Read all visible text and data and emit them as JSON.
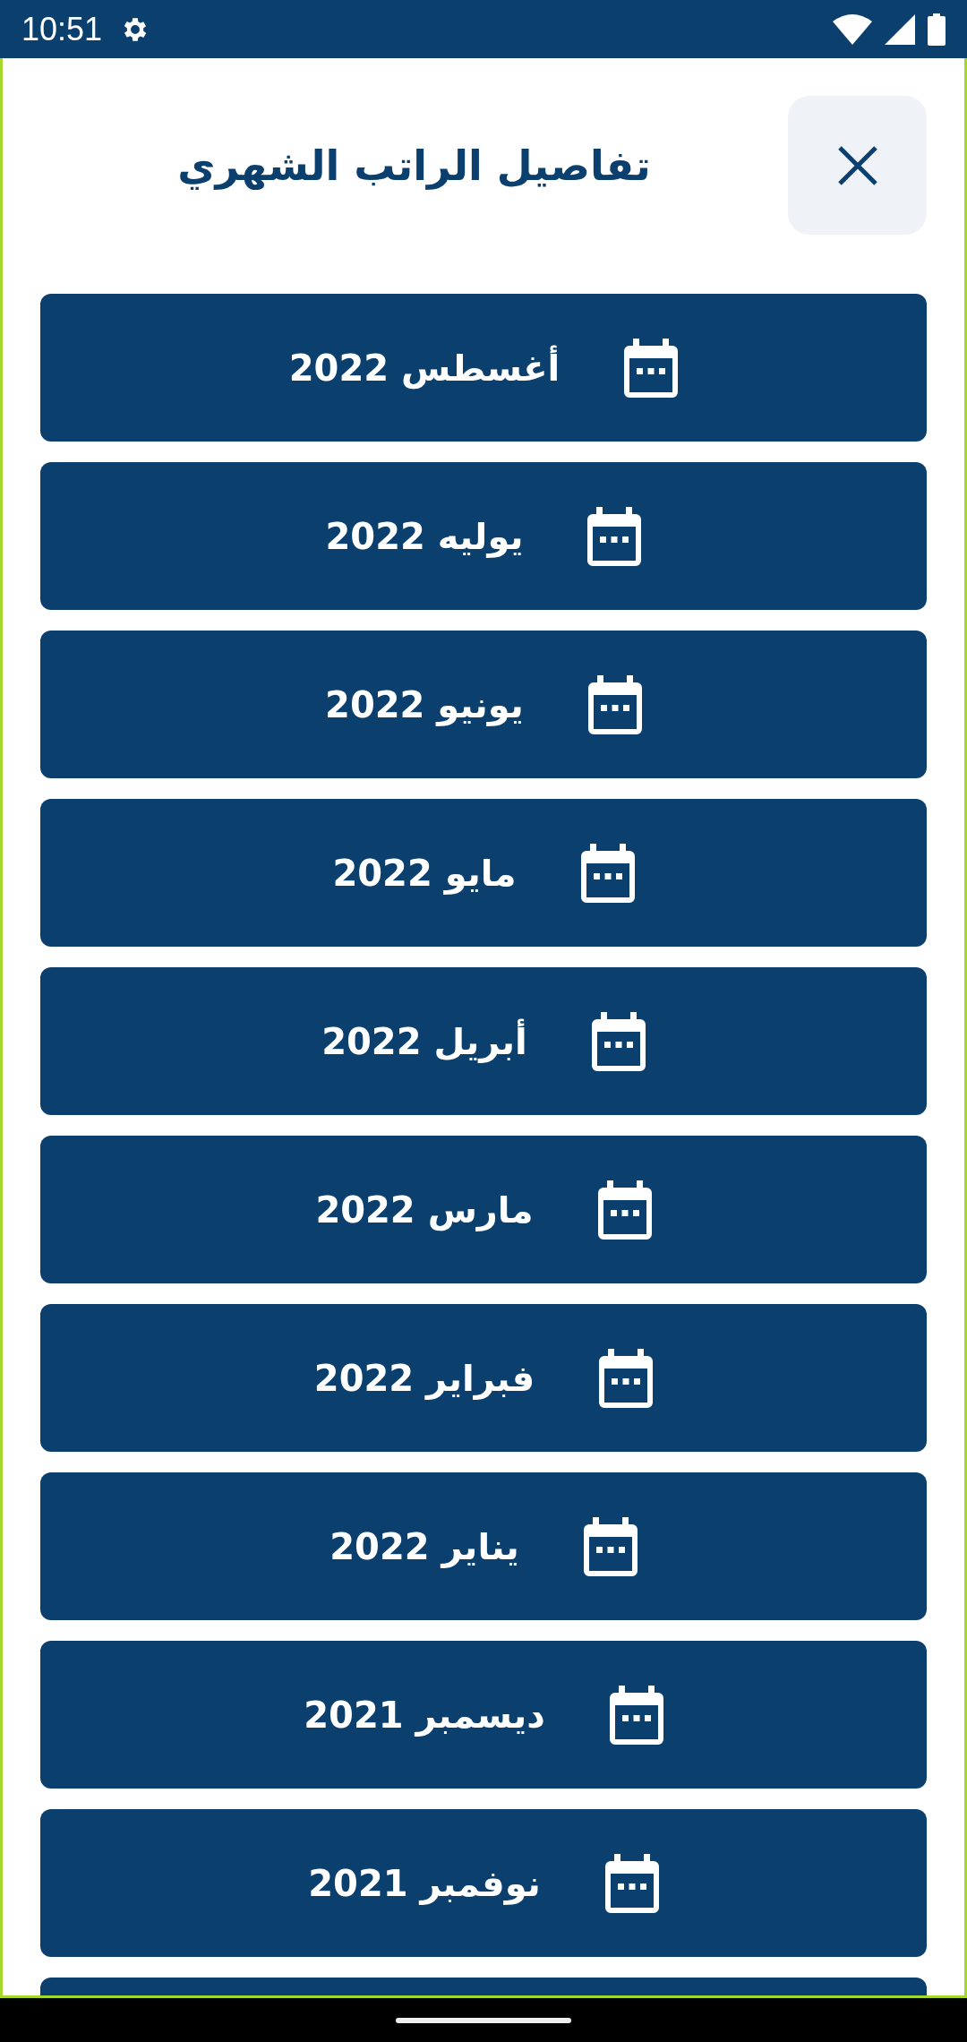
{
  "status_bar": {
    "time": "10:51"
  },
  "header": {
    "title": "تفاصيل الراتب الشهري"
  },
  "months": [
    {
      "label": "أغسطس 2022"
    },
    {
      "label": "يوليه 2022"
    },
    {
      "label": "يونيو 2022"
    },
    {
      "label": "مايو 2022"
    },
    {
      "label": "أبريل 2022"
    },
    {
      "label": "مارس 2022"
    },
    {
      "label": "فبراير 2022"
    },
    {
      "label": "يناير 2022"
    },
    {
      "label": "ديسمبر 2021"
    },
    {
      "label": "نوفمبر 2021"
    }
  ],
  "more_items_below": true
}
